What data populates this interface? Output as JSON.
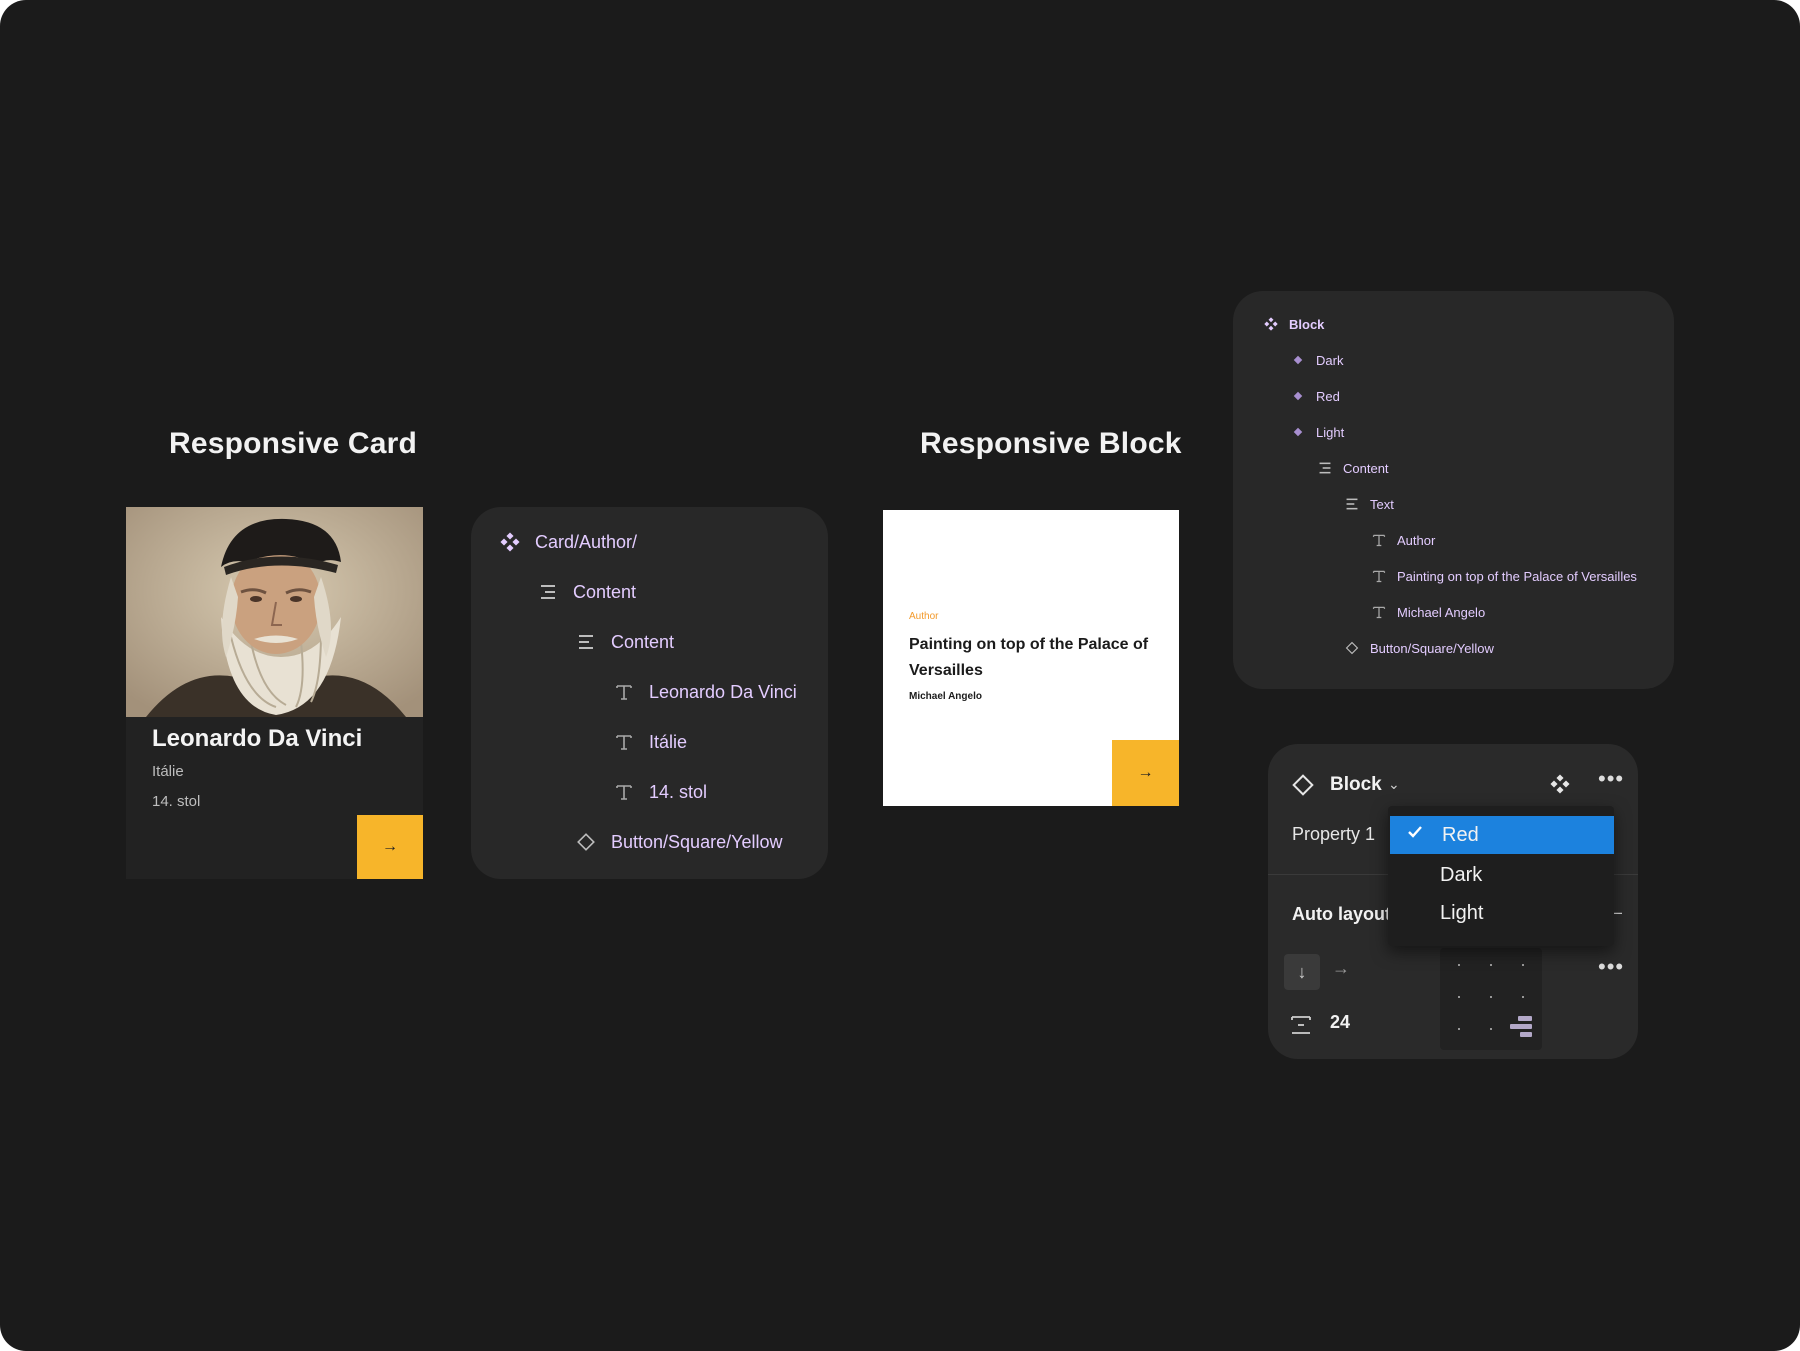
{
  "card_section": {
    "title": "Responsive Card",
    "card": {
      "name": "Leonardo Da Vinci",
      "country": "Itálie",
      "century": "14. stol",
      "button_icon": "arrow-right-icon"
    }
  },
  "card_layers": {
    "component": "Card/Author/",
    "content_outer": "Content",
    "content_inner": "Content",
    "text_name": "Leonardo Da Vinci",
    "text_country": "Itálie",
    "text_century": "14. stol",
    "button_instance": "Button/Square/Yellow"
  },
  "block_section": {
    "title": "Responsive Block",
    "block": {
      "author_label": "Author",
      "title": "Painting on top of the Palace of Versailles",
      "painter": "Michael Angelo",
      "button_icon": "arrow-right-icon"
    }
  },
  "block_layers": {
    "component_set": "Block",
    "variant_dark": "Dark",
    "variant_red": "Red",
    "variant_light": "Light",
    "content": "Content",
    "text_group": "Text",
    "text_author": "Author",
    "text_title": "Painting on top of the Palace of Versailles",
    "text_painter": "Michael Angelo",
    "button_instance": "Button/Square/Yellow"
  },
  "properties_panel": {
    "instance_name": "Block",
    "property_label": "Property 1",
    "dropdown_options": [
      "Red",
      "Dark",
      "Light"
    ],
    "selected_option": "Red",
    "auto_layout_label": "Auto layout",
    "gap_value": "24"
  },
  "colors": {
    "background": "#1b1b1b",
    "panel": "#282828",
    "accent_yellow": "#f7b52a",
    "layer_text": "#e3ccff",
    "author_orange": "#f39a2b",
    "selection_blue": "#1c82de"
  }
}
